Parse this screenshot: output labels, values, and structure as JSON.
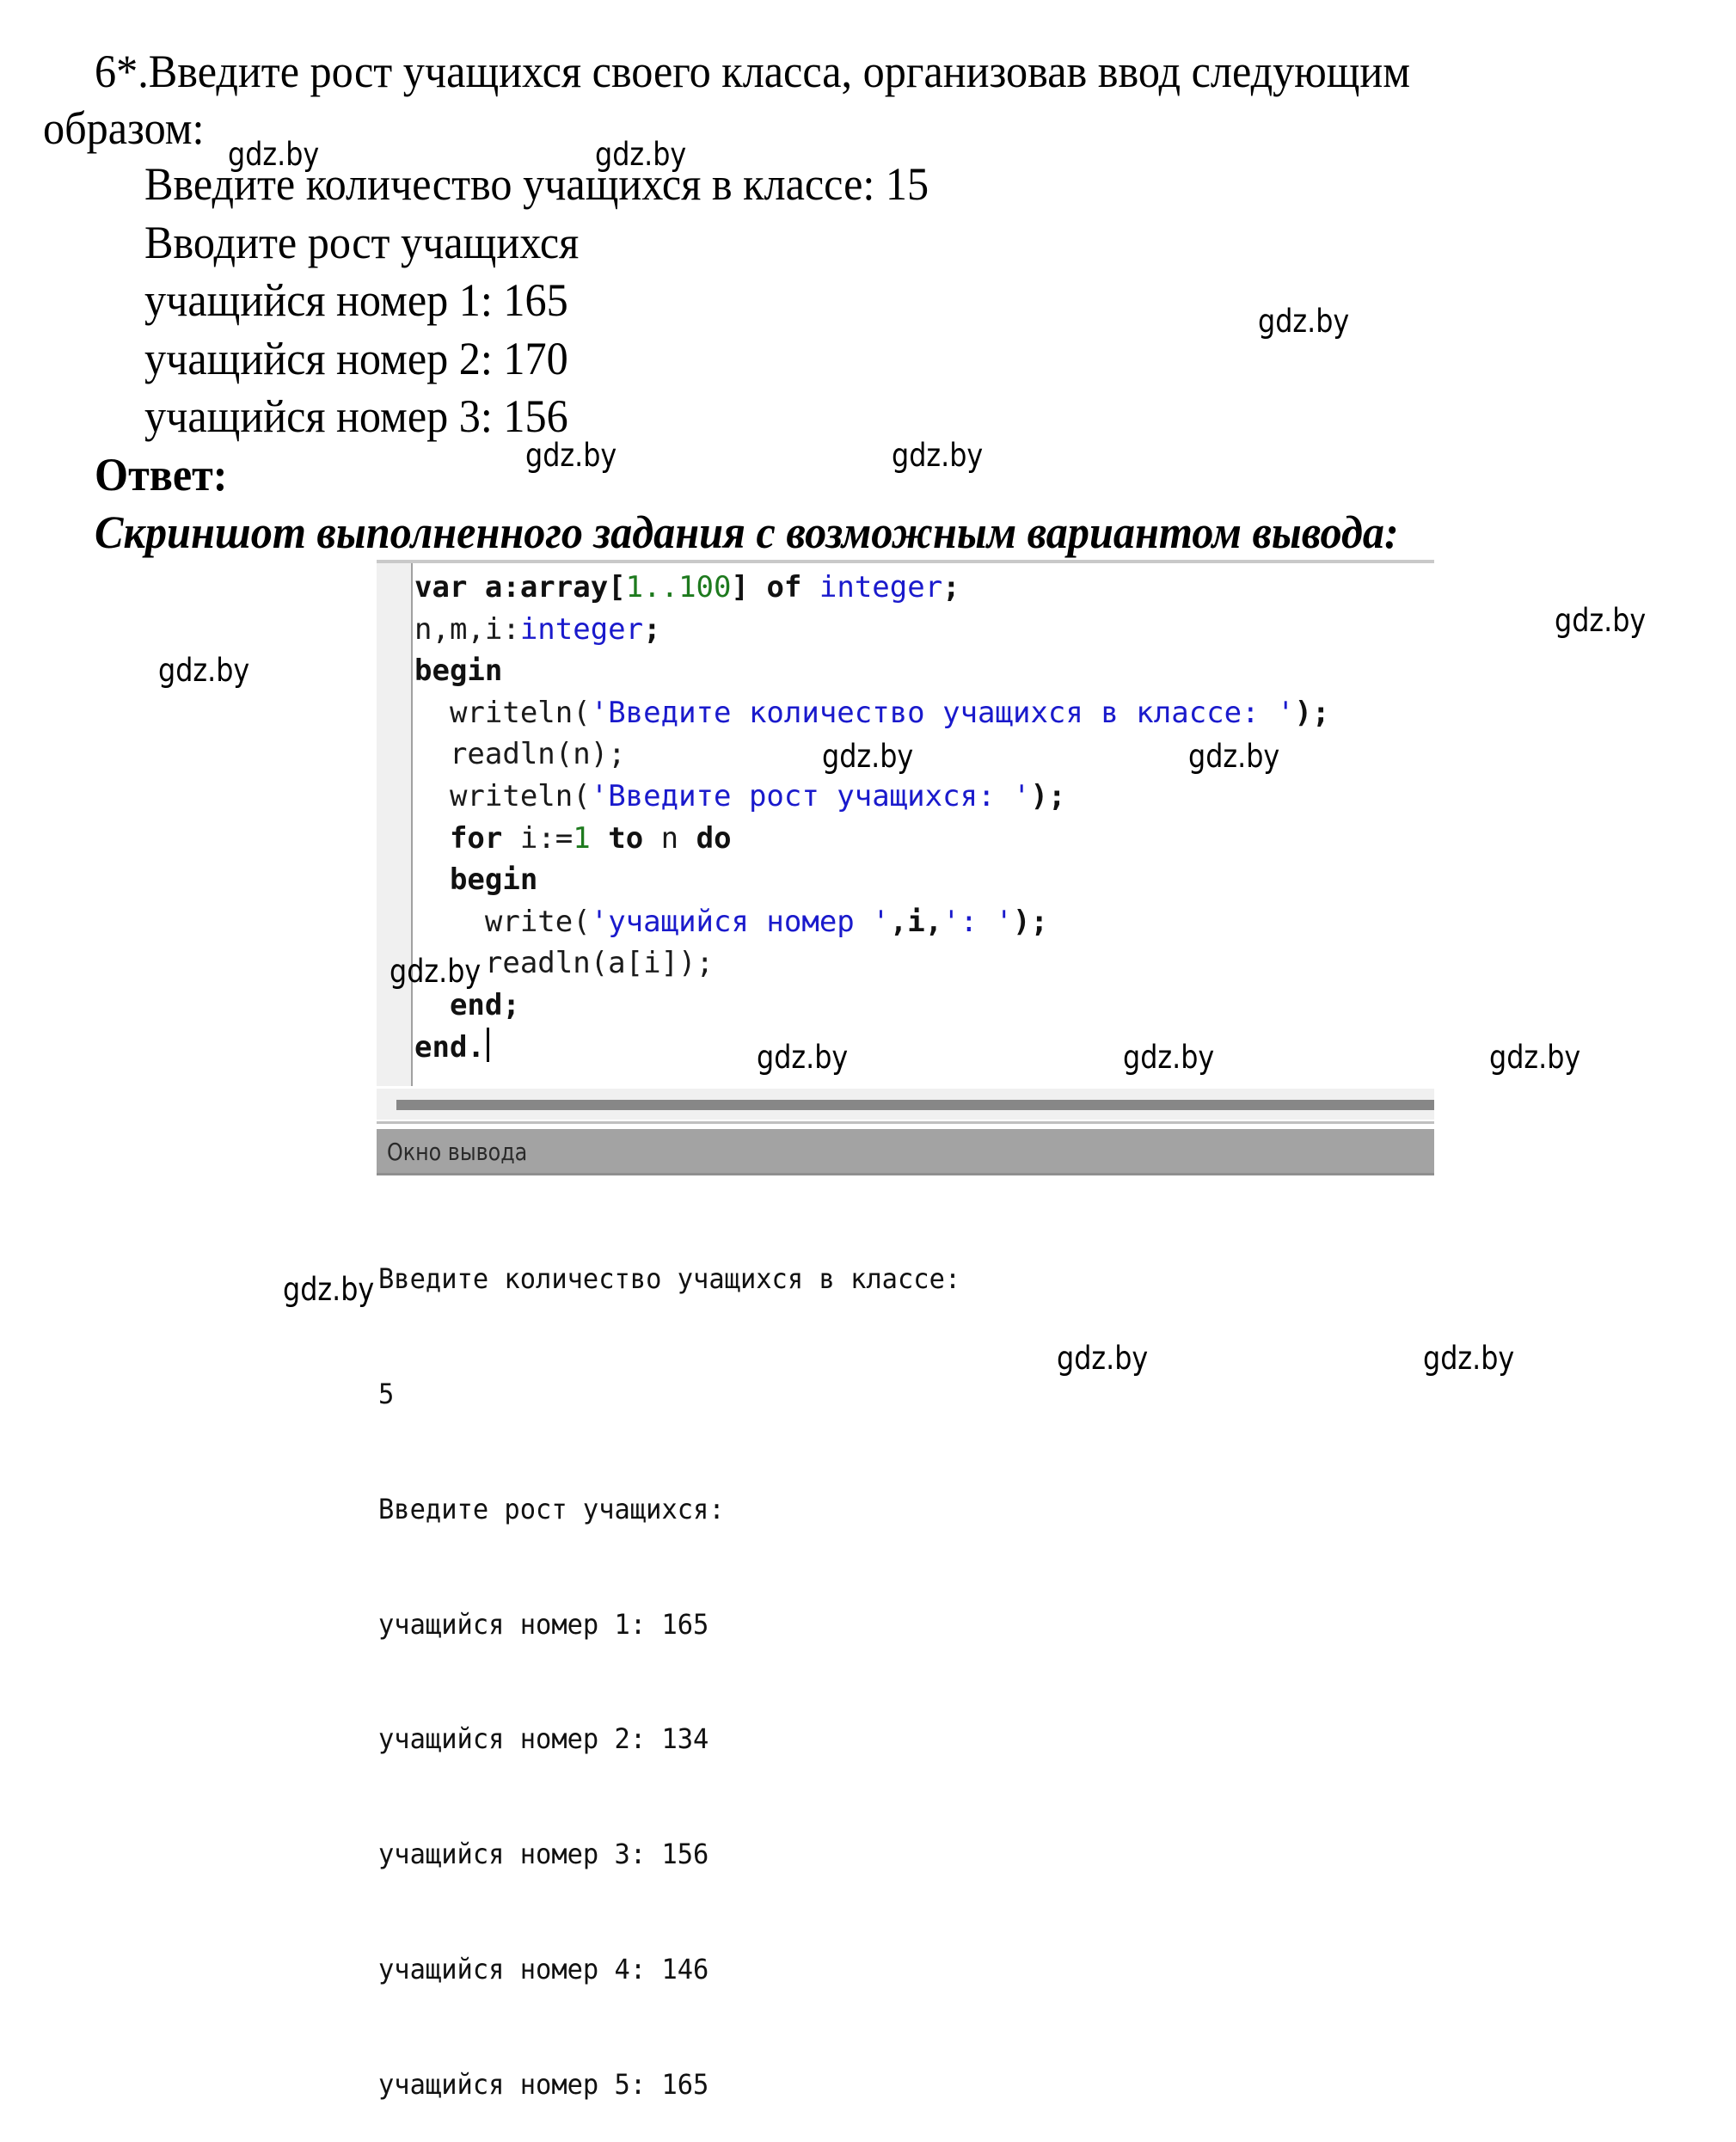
{
  "task": {
    "line1": "6*.Введите  рост  учащихся  своего  класса,  организовав  ввод  следующим",
    "line2": "образом:"
  },
  "sample_dialog": [
    "Введите количество учащихся в классе: 15",
    "Вводите рост учащихся",
    "учащийся номер 1: 165",
    "учащийся номер 2: 170",
    "учащийся номер 3: 156"
  ],
  "answer": {
    "label": "Ответ:",
    "subtitle": "Скриншот выполненного задания с возможным вариантом вывода:"
  },
  "editor": {
    "lines": [
      {
        "indent": "",
        "tokens": [
          {
            "t": "var",
            "c": "kw"
          },
          {
            "t": " a:array[",
            "c": "kw"
          },
          {
            "t": "1..100",
            "c": "num"
          },
          {
            "t": "] ",
            "c": "kw"
          },
          {
            "t": "of",
            "c": "kw"
          },
          {
            "t": " ",
            "c": "kw"
          },
          {
            "t": "integer",
            "c": "typ"
          },
          {
            "t": ";",
            "c": "kw"
          }
        ]
      },
      {
        "indent": "",
        "tokens": [
          {
            "t": "n,m,i:",
            "c": "plain"
          },
          {
            "t": "integer",
            "c": "typ"
          },
          {
            "t": ";",
            "c": "kw"
          }
        ]
      },
      {
        "indent": "",
        "tokens": [
          {
            "t": "begin",
            "c": "kw"
          }
        ]
      },
      {
        "indent": "  ",
        "tokens": [
          {
            "t": "writeln(",
            "c": "plain"
          },
          {
            "t": "'Введите количество учащихся в классе: '",
            "c": "str"
          },
          {
            "t": ");",
            "c": "kw"
          }
        ]
      },
      {
        "indent": "  ",
        "tokens": [
          {
            "t": "readln(n);",
            "c": "plain"
          }
        ]
      },
      {
        "indent": "  ",
        "tokens": [
          {
            "t": "writeln(",
            "c": "plain"
          },
          {
            "t": "'Введите рост учащихся: '",
            "c": "str"
          },
          {
            "t": ");",
            "c": "kw"
          }
        ]
      },
      {
        "indent": "  ",
        "tokens": [
          {
            "t": "for",
            "c": "kw"
          },
          {
            "t": " i:=",
            "c": "plain"
          },
          {
            "t": "1",
            "c": "num"
          },
          {
            "t": " ",
            "c": "plain"
          },
          {
            "t": "to",
            "c": "kw"
          },
          {
            "t": " n ",
            "c": "plain"
          },
          {
            "t": "do",
            "c": "kw"
          }
        ]
      },
      {
        "indent": "  ",
        "tokens": [
          {
            "t": "begin",
            "c": "kw"
          }
        ]
      },
      {
        "indent": "    ",
        "tokens": [
          {
            "t": "write(",
            "c": "plain"
          },
          {
            "t": "'учащийся номер '",
            "c": "str"
          },
          {
            "t": ",i,",
            "c": "kw"
          },
          {
            "t": "': '",
            "c": "str"
          },
          {
            "t": ");",
            "c": "kw"
          }
        ]
      },
      {
        "indent": "    ",
        "tokens": [
          {
            "t": "readln(a[i]);",
            "c": "plain"
          }
        ]
      },
      {
        "indent": "  ",
        "tokens": [
          {
            "t": "end;",
            "c": "kw"
          }
        ]
      },
      {
        "indent": "",
        "tokens": [
          {
            "t": "end.",
            "c": "kw"
          }
        ],
        "caret": true
      }
    ]
  },
  "output_window": {
    "title": "Окно вывода",
    "lines": [
      "Введите количество учащихся в классе:",
      "5",
      "Введите рост учащихся:",
      "учащийся номер 1: 165",
      "учащийся номер 2: 134",
      "учащийся номер 3: 156",
      "учащийся номер 4: 146",
      "учащийся номер 5: 165"
    ]
  },
  "watermark": {
    "text": "gdz.by",
    "count": 16
  },
  "colors": {
    "string": "#1a1acc",
    "number": "#1e7a1e",
    "keyword": "#111111",
    "output_header_bg": "#a3a3a3",
    "scroll_thumb": "#878787"
  }
}
